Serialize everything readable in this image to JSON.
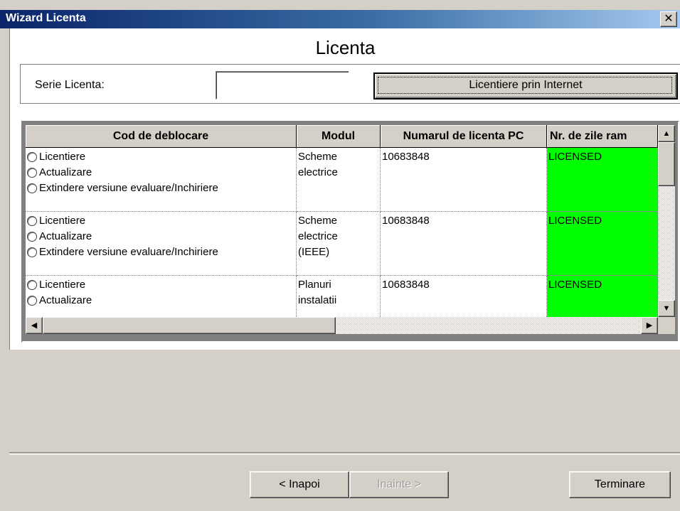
{
  "window": {
    "title": "Wizard Licenta",
    "close_glyph": "✕"
  },
  "page": {
    "heading": "Licenta"
  },
  "serie": {
    "label": "Serie Licenta:",
    "value": "",
    "internet_button": "Licentiere prin Internet"
  },
  "grid": {
    "columns": [
      "Cod de deblocare",
      "Modul",
      "Numarul de licenta PC",
      "Nr. de zile ram"
    ],
    "rows": [
      {
        "options": [
          "Licentiere",
          "Actualizare",
          "Extindere versiune evaluare/Inchiriere"
        ],
        "modul": [
          "Scheme",
          "electrice"
        ],
        "license_pc": "10683848",
        "days": "LICENSED"
      },
      {
        "options": [
          "Licentiere",
          "Actualizare",
          "Extindere versiune evaluare/Inchiriere"
        ],
        "modul": [
          "Scheme",
          "electrice",
          "(IEEE)"
        ],
        "license_pc": "10683848",
        "days": "LICENSED"
      },
      {
        "options": [
          "Licentiere",
          "Actualizare"
        ],
        "modul": [
          "Planuri",
          "instalatii"
        ],
        "license_pc": "10683848",
        "days": "LICENSED"
      }
    ],
    "scroll_glyphs": {
      "up": "▲",
      "down": "▼",
      "left": "◀",
      "right": "▶"
    },
    "licensed_color": "#00ff00"
  },
  "buttons": {
    "back": "< Inapoi",
    "next": "Inainte >",
    "finish": "Terminare"
  }
}
